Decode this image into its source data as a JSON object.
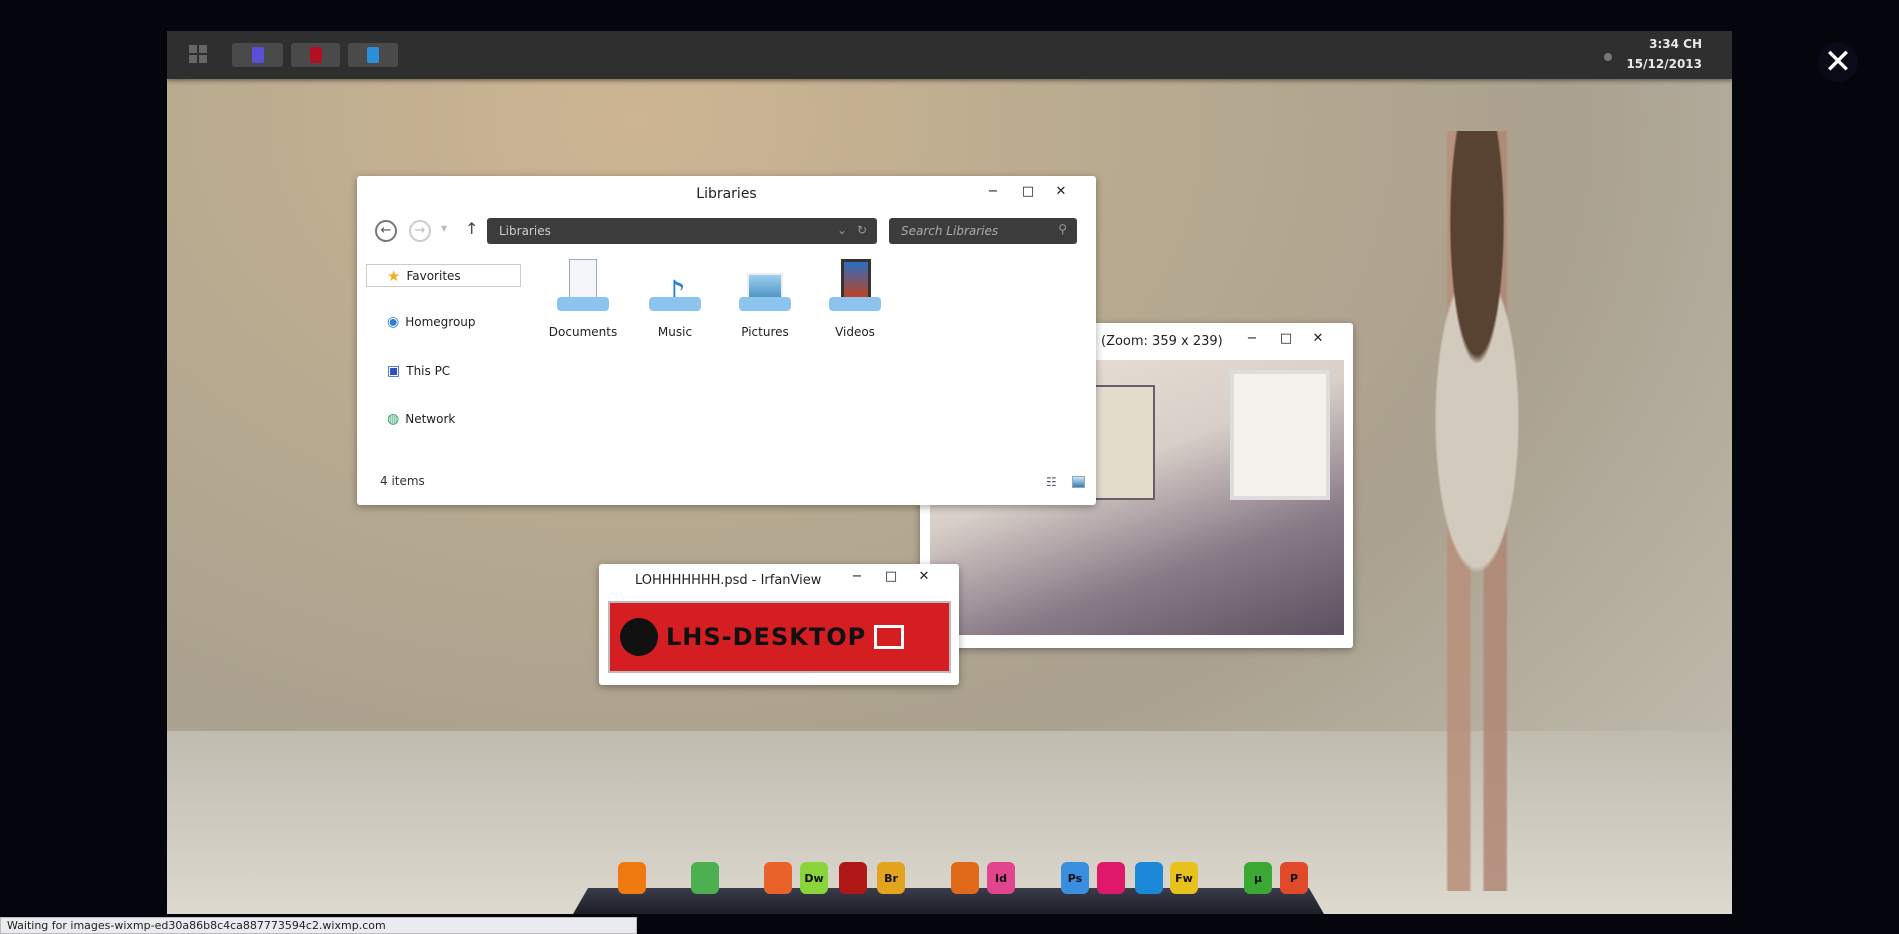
{
  "taskbar": {
    "buttons": [
      {
        "icon": "calendar-app-icon",
        "color": "#5a4fd6"
      },
      {
        "icon": "target-app-icon",
        "color": "#b01020"
      },
      {
        "icon": "smiley-app-icon",
        "color": "#2a8fd6"
      }
    ],
    "time": "3:34 CH",
    "date": "15/12/2013"
  },
  "explorer": {
    "title": "Libraries",
    "address": "Libraries",
    "search_placeholder": "Search Libraries",
    "sidebar": [
      {
        "label": "Favorites",
        "icon": "star-icon"
      },
      {
        "label": "Homegroup",
        "icon": "homegroup-icon"
      },
      {
        "label": "This PC",
        "icon": "computer-icon"
      },
      {
        "label": "Network",
        "icon": "network-icon"
      }
    ],
    "libraries": [
      {
        "label": "Documents",
        "icon": "documents-icon"
      },
      {
        "label": "Music",
        "icon": "music-icon"
      },
      {
        "label": "Pictures",
        "icon": "pictures-icon"
      },
      {
        "label": "Videos",
        "icon": "videos-icon"
      }
    ],
    "status": "4 items"
  },
  "viewer": {
    "title": "(Zoom: 359 x 239)"
  },
  "irfanview": {
    "title": "LOHHHHHHH.psd - IrfanView",
    "banner_text": "LHS-DESKTOP"
  },
  "controls": {
    "minimize": "−",
    "maximize": "□",
    "close": "✕"
  },
  "dock": [
    {
      "name": "xampp",
      "label": "",
      "color": "#f07a10"
    },
    {
      "name": "chrome",
      "label": "",
      "color": "#4caf50"
    },
    {
      "name": "firefox",
      "label": "",
      "color": "#e8622a"
    },
    {
      "name": "dreamweaver",
      "label": "Dw",
      "color": "#8ad63a"
    },
    {
      "name": "filezilla",
      "label": "",
      "color": "#b01818"
    },
    {
      "name": "bridge",
      "label": "Br",
      "color": "#e2a41c"
    },
    {
      "name": "flash",
      "label": "",
      "color": "#e06a1a"
    },
    {
      "name": "indesign",
      "label": "Id",
      "color": "#e0458e"
    },
    {
      "name": "photoshop",
      "label": "Ps",
      "color": "#3a8ee0"
    },
    {
      "name": "media-player",
      "label": "",
      "color": "#e0186a"
    },
    {
      "name": "remote-desktop",
      "label": "",
      "color": "#1e88d8"
    },
    {
      "name": "fireworks",
      "label": "Fw",
      "color": "#e8c21c"
    },
    {
      "name": "utorrent",
      "label": "µ",
      "color": "#3aa832"
    },
    {
      "name": "powerpoint",
      "label": "P",
      "color": "#e04a2a"
    }
  ],
  "status_bar": "Waiting for images-wixmp-ed30a86b8c4ca887773594c2.wixmp.com",
  "close_overlay": "✕"
}
